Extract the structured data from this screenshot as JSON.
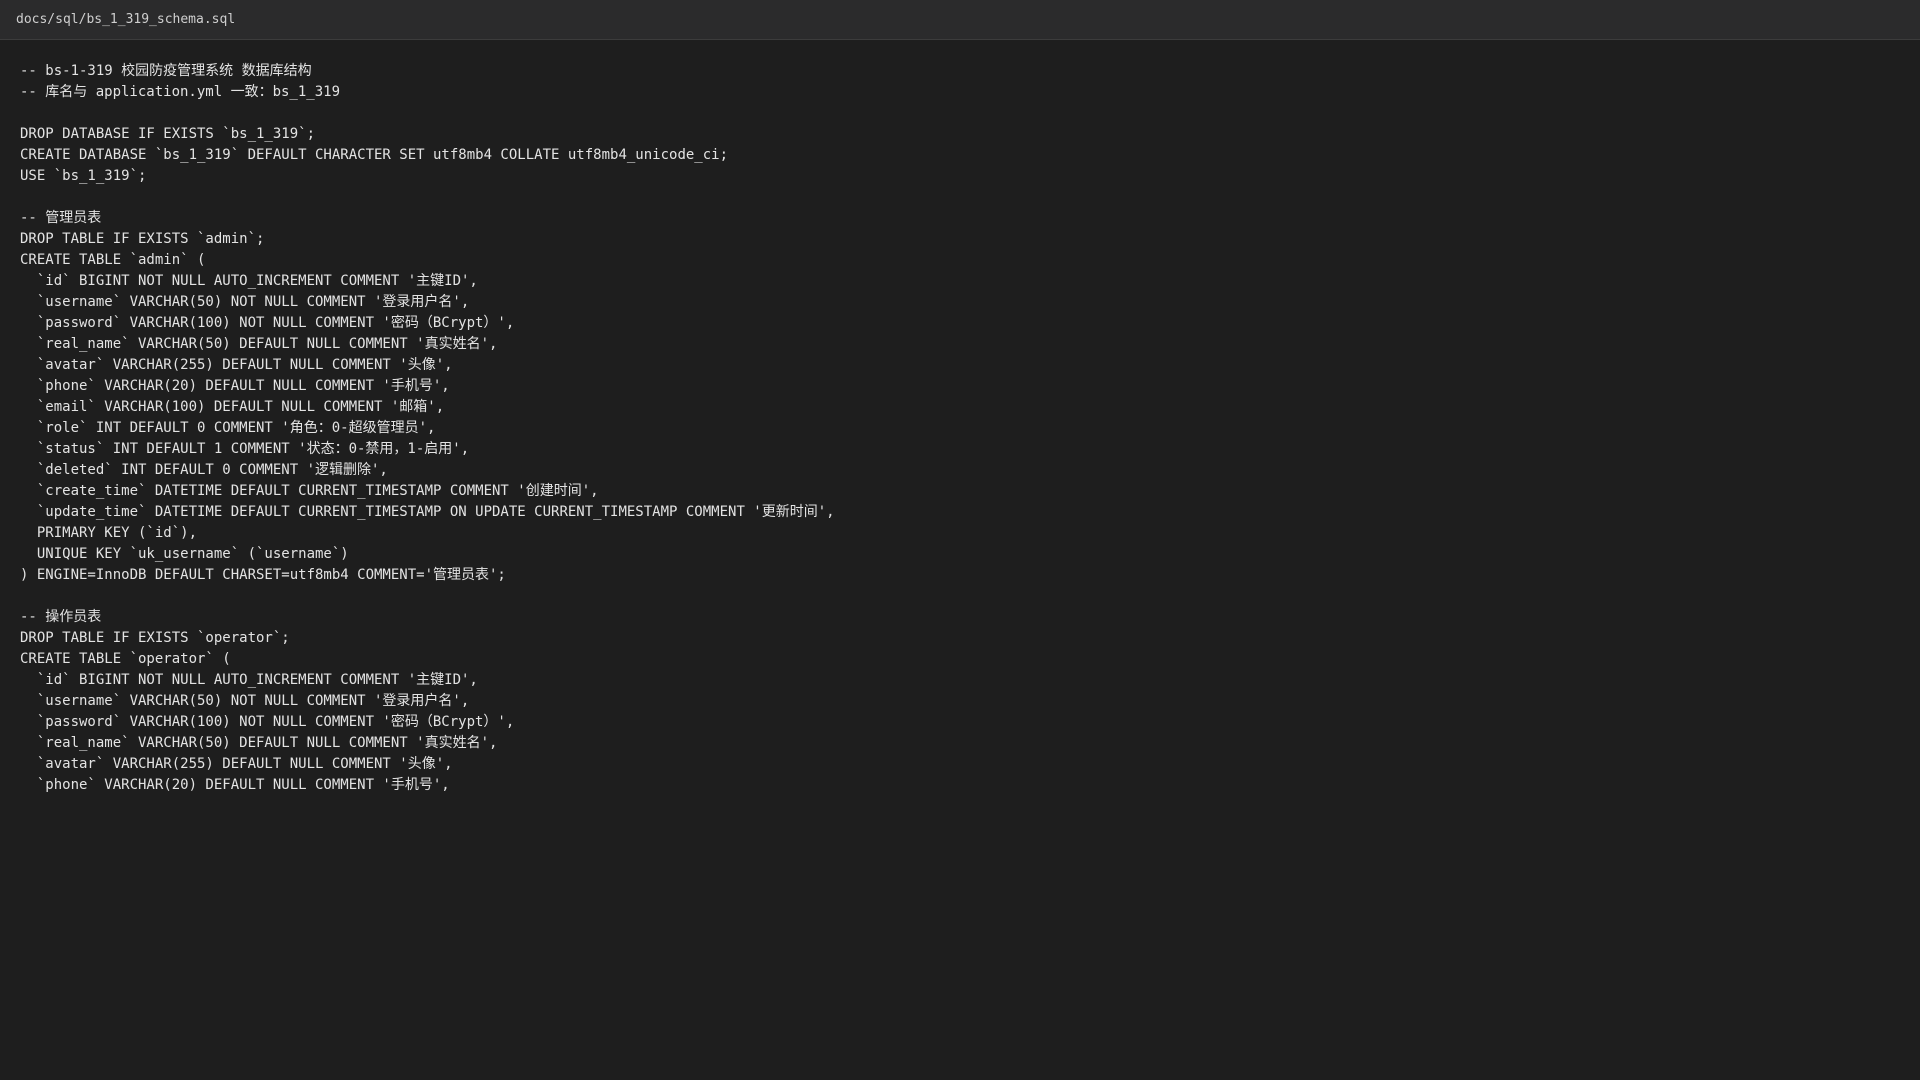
{
  "file": {
    "path": "docs/sql/bs_1_319_schema.sql"
  },
  "code": {
    "lines": [
      "-- bs-1-319 校园防疫管理系统 数据库结构",
      "-- 库名与 application.yml 一致：bs_1_319",
      "",
      "DROP DATABASE IF EXISTS `bs_1_319`;",
      "CREATE DATABASE `bs_1_319` DEFAULT CHARACTER SET utf8mb4 COLLATE utf8mb4_unicode_ci;",
      "USE `bs_1_319`;",
      "",
      "-- 管理员表",
      "DROP TABLE IF EXISTS `admin`;",
      "CREATE TABLE `admin` (",
      "  `id` BIGINT NOT NULL AUTO_INCREMENT COMMENT '主键ID',",
      "  `username` VARCHAR(50) NOT NULL COMMENT '登录用户名',",
      "  `password` VARCHAR(100) NOT NULL COMMENT '密码（BCrypt）',",
      "  `real_name` VARCHAR(50) DEFAULT NULL COMMENT '真实姓名',",
      "  `avatar` VARCHAR(255) DEFAULT NULL COMMENT '头像',",
      "  `phone` VARCHAR(20) DEFAULT NULL COMMENT '手机号',",
      "  `email` VARCHAR(100) DEFAULT NULL COMMENT '邮箱',",
      "  `role` INT DEFAULT 0 COMMENT '角色：0-超级管理员',",
      "  `status` INT DEFAULT 1 COMMENT '状态：0-禁用，1-启用',",
      "  `deleted` INT DEFAULT 0 COMMENT '逻辑删除',",
      "  `create_time` DATETIME DEFAULT CURRENT_TIMESTAMP COMMENT '创建时间',",
      "  `update_time` DATETIME DEFAULT CURRENT_TIMESTAMP ON UPDATE CURRENT_TIMESTAMP COMMENT '更新时间',",
      "  PRIMARY KEY (`id`),",
      "  UNIQUE KEY `uk_username` (`username`)",
      ") ENGINE=InnoDB DEFAULT CHARSET=utf8mb4 COMMENT='管理员表';",
      "",
      "-- 操作员表",
      "DROP TABLE IF EXISTS `operator`;",
      "CREATE TABLE `operator` (",
      "  `id` BIGINT NOT NULL AUTO_INCREMENT COMMENT '主键ID',",
      "  `username` VARCHAR(50) NOT NULL COMMENT '登录用户名',",
      "  `password` VARCHAR(100) NOT NULL COMMENT '密码（BCrypt）',",
      "  `real_name` VARCHAR(50) DEFAULT NULL COMMENT '真实姓名',",
      "  `avatar` VARCHAR(255) DEFAULT NULL COMMENT '头像',",
      "  `phone` VARCHAR(20) DEFAULT NULL COMMENT '手机号',"
    ]
  },
  "theme": {
    "background": "#1e1e1e",
    "title_bar": "#2b2b2c",
    "text": "#e3e3e3"
  }
}
